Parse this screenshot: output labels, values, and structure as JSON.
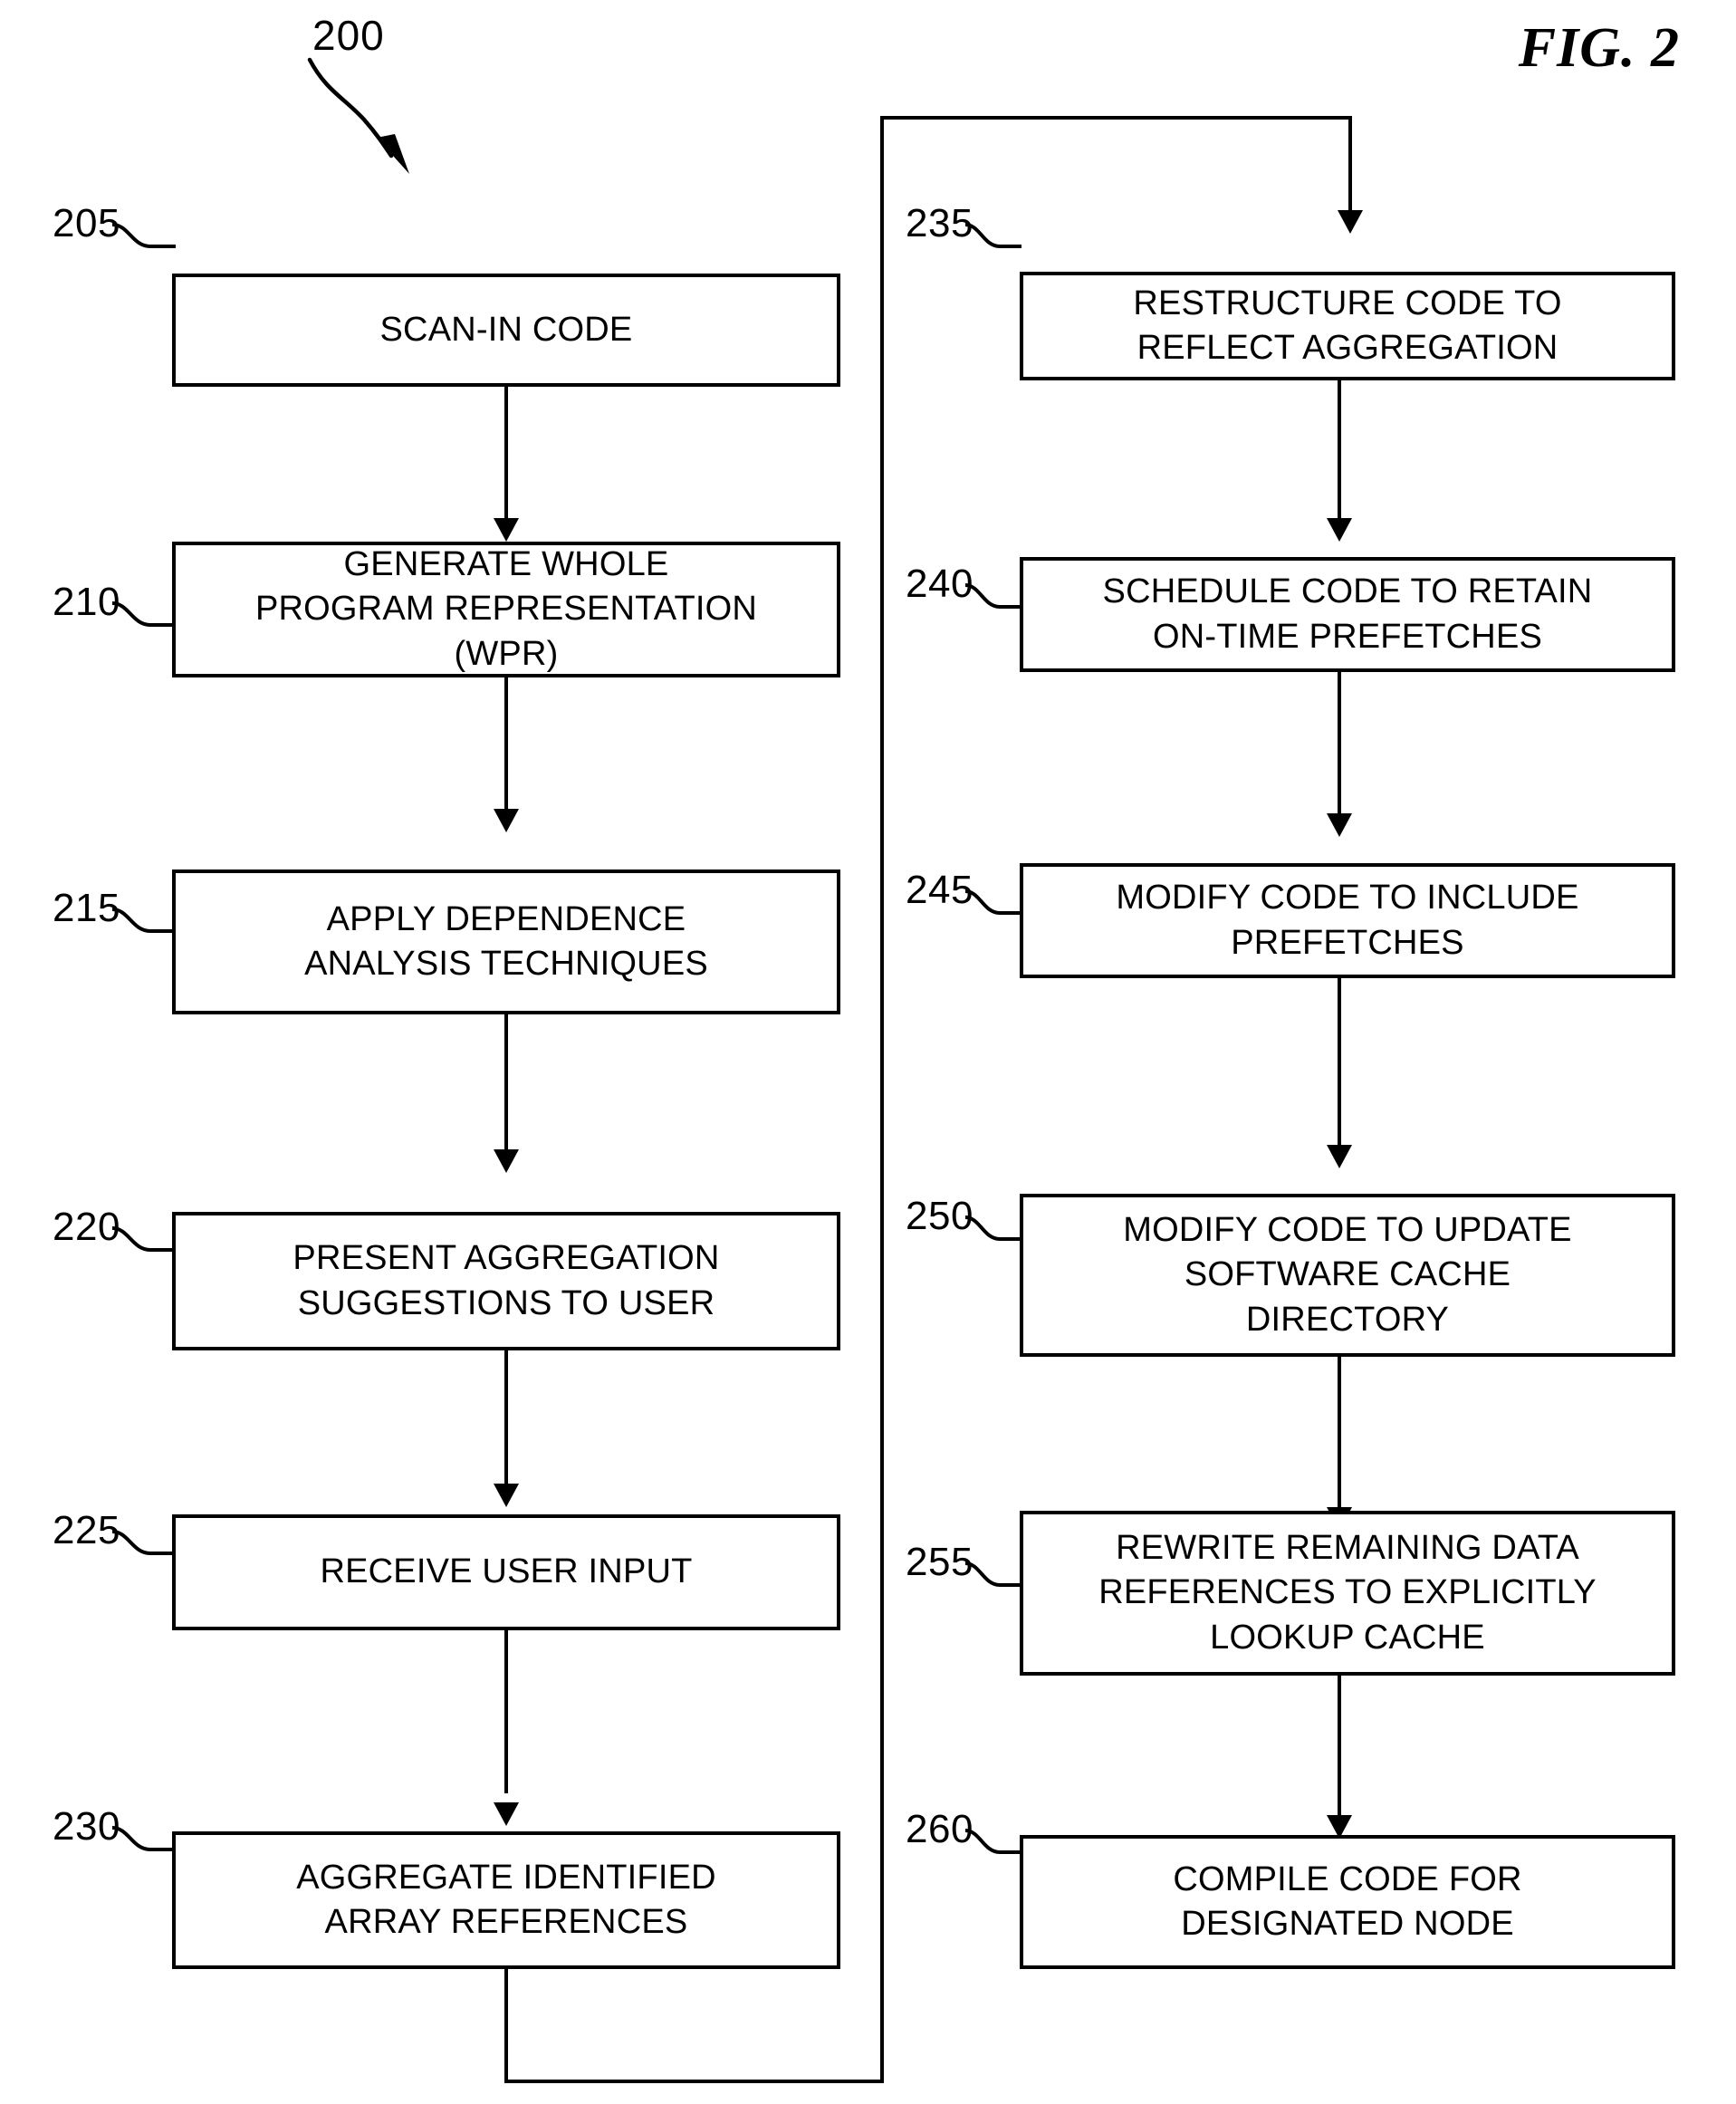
{
  "figure": {
    "title": "FIG. 2",
    "diagram_number": "200"
  },
  "flowchart": {
    "left_column": [
      {
        "ref": "205",
        "text": "SCAN-IN CODE"
      },
      {
        "ref": "210",
        "text": "GENERATE WHOLE\nPROGRAM REPRESENTATION\n(WPR)"
      },
      {
        "ref": "215",
        "text": "APPLY DEPENDENCE\nANALYSIS TECHNIQUES"
      },
      {
        "ref": "220",
        "text": "PRESENT AGGREGATION\nSUGGESTIONS TO USER"
      },
      {
        "ref": "225",
        "text": "RECEIVE USER INPUT"
      },
      {
        "ref": "230",
        "text": "AGGREGATE IDENTIFIED\nARRAY REFERENCES"
      }
    ],
    "right_column": [
      {
        "ref": "235",
        "text": "RESTRUCTURE CODE TO\nREFLECT AGGREGATION"
      },
      {
        "ref": "240",
        "text": "SCHEDULE CODE TO RETAIN\nON-TIME PREFETCHES"
      },
      {
        "ref": "245",
        "text": "MODIFY CODE TO INCLUDE\nPREFETCHES"
      },
      {
        "ref": "250",
        "text": "MODIFY CODE TO UPDATE\nSOFTWARE CACHE\nDIRECTORY"
      },
      {
        "ref": "255",
        "text": "REWRITE REMAINING DATA\nREFERENCES TO EXPLICITLY\nLOOKUP CACHE"
      },
      {
        "ref": "260",
        "text": "COMPILE CODE FOR\nDESIGNATED NODE"
      }
    ]
  },
  "colors": {
    "ink": "#000000",
    "paper": "#ffffff"
  }
}
